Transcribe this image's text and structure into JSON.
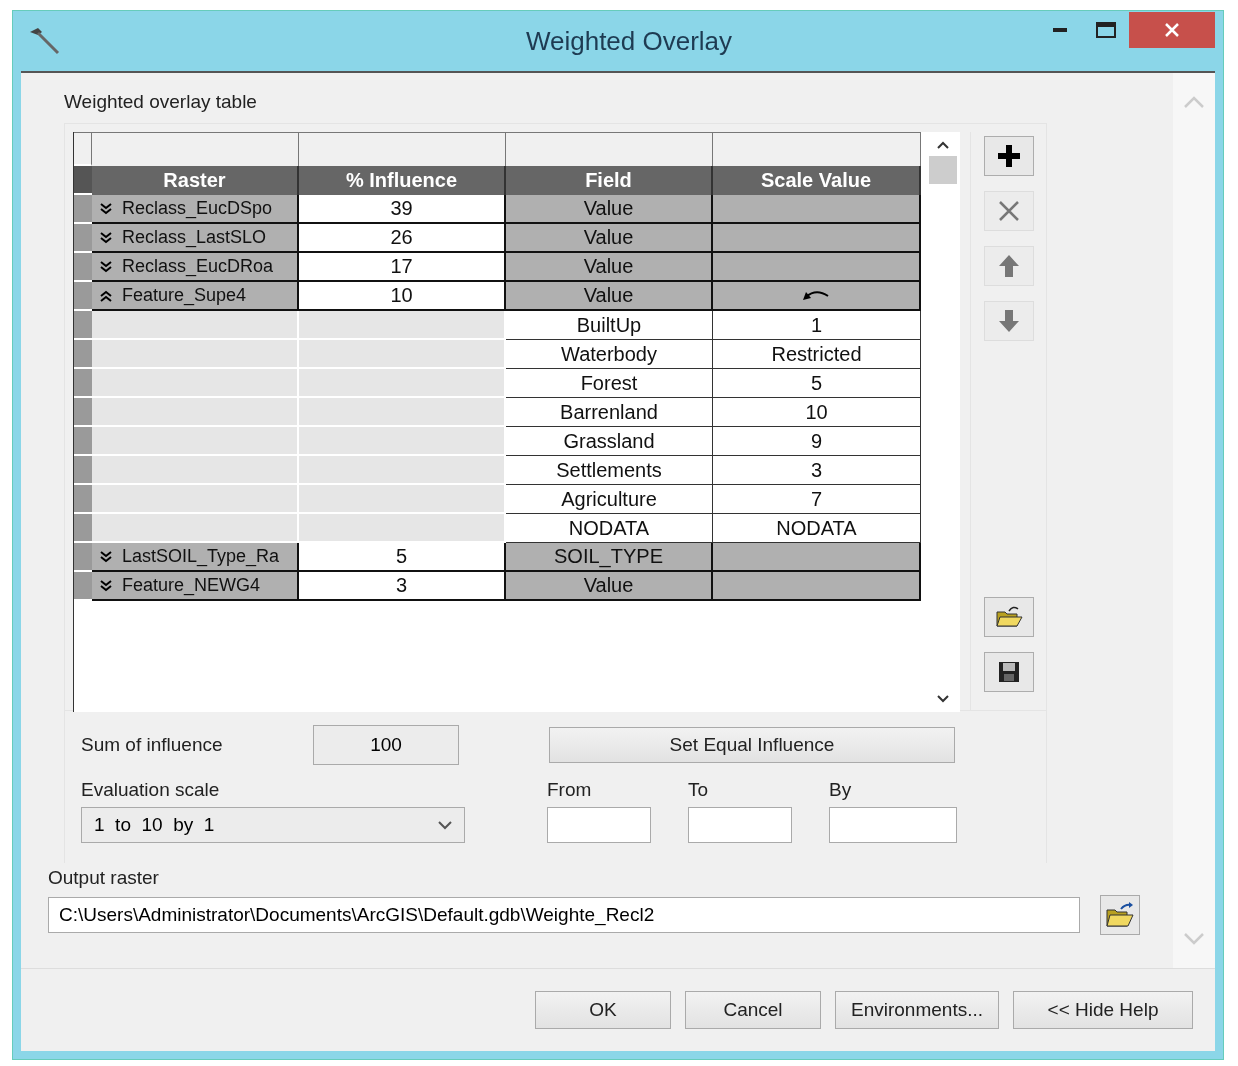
{
  "window": {
    "title": "Weighted Overlay"
  },
  "table_label": "Weighted overlay table",
  "table": {
    "columns": [
      "Raster",
      "% Influence",
      "Field",
      "Scale Value"
    ],
    "rows": [
      {
        "raster": "Reclass_EucDSpo",
        "influence": "39",
        "field": "Value",
        "expanded": false,
        "classes": []
      },
      {
        "raster": "Reclass_LastSLO",
        "influence": "26",
        "field": "Value",
        "expanded": false,
        "classes": []
      },
      {
        "raster": "Reclass_EucDRoa",
        "influence": "17",
        "field": "Value",
        "expanded": false,
        "classes": []
      },
      {
        "raster": "Feature_Supe4",
        "influence": "10",
        "field": "Value",
        "expanded": true,
        "classes": [
          {
            "field": "BuiltUp",
            "scale": "1"
          },
          {
            "field": "Waterbody",
            "scale": "Restricted"
          },
          {
            "field": "Forest",
            "scale": "5"
          },
          {
            "field": "Barrenland",
            "scale": "10"
          },
          {
            "field": "Grassland",
            "scale": "9"
          },
          {
            "field": "Settlements",
            "scale": "3"
          },
          {
            "field": "Agriculture",
            "scale": "7"
          },
          {
            "field": "NODATA",
            "scale": "NODATA"
          }
        ]
      },
      {
        "raster": "LastSOIL_Type_Ra",
        "influence": "5",
        "field": "SOIL_TYPE",
        "expanded": false,
        "classes": []
      },
      {
        "raster": "Feature_NEWG4",
        "influence": "3",
        "field": "Value",
        "expanded": false,
        "classes": []
      }
    ]
  },
  "tools": [
    {
      "kind": "add",
      "disabled": false
    },
    {
      "kind": "remove",
      "disabled": true
    },
    {
      "kind": "up",
      "disabled": true
    },
    {
      "kind": "down",
      "disabled": true
    },
    {
      "kind": "open",
      "disabled": false
    },
    {
      "kind": "save",
      "disabled": false
    }
  ],
  "sum": {
    "label": "Sum of influence",
    "value": "100"
  },
  "equal_button": "Set Equal Influence",
  "evaluation": {
    "label": "Evaluation scale",
    "value": "1  to  10  by  1"
  },
  "range": [
    {
      "label": "From"
    },
    {
      "label": "To"
    },
    {
      "label": "By"
    }
  ],
  "output": {
    "label": "Output raster",
    "value": "C:\\Users\\Administrator\\Documents\\ArcGIS\\Default.gdb\\Weighte_Recl2"
  },
  "buttons": [
    "OK",
    "Cancel",
    "Environments...",
    "<< Hide Help"
  ]
}
